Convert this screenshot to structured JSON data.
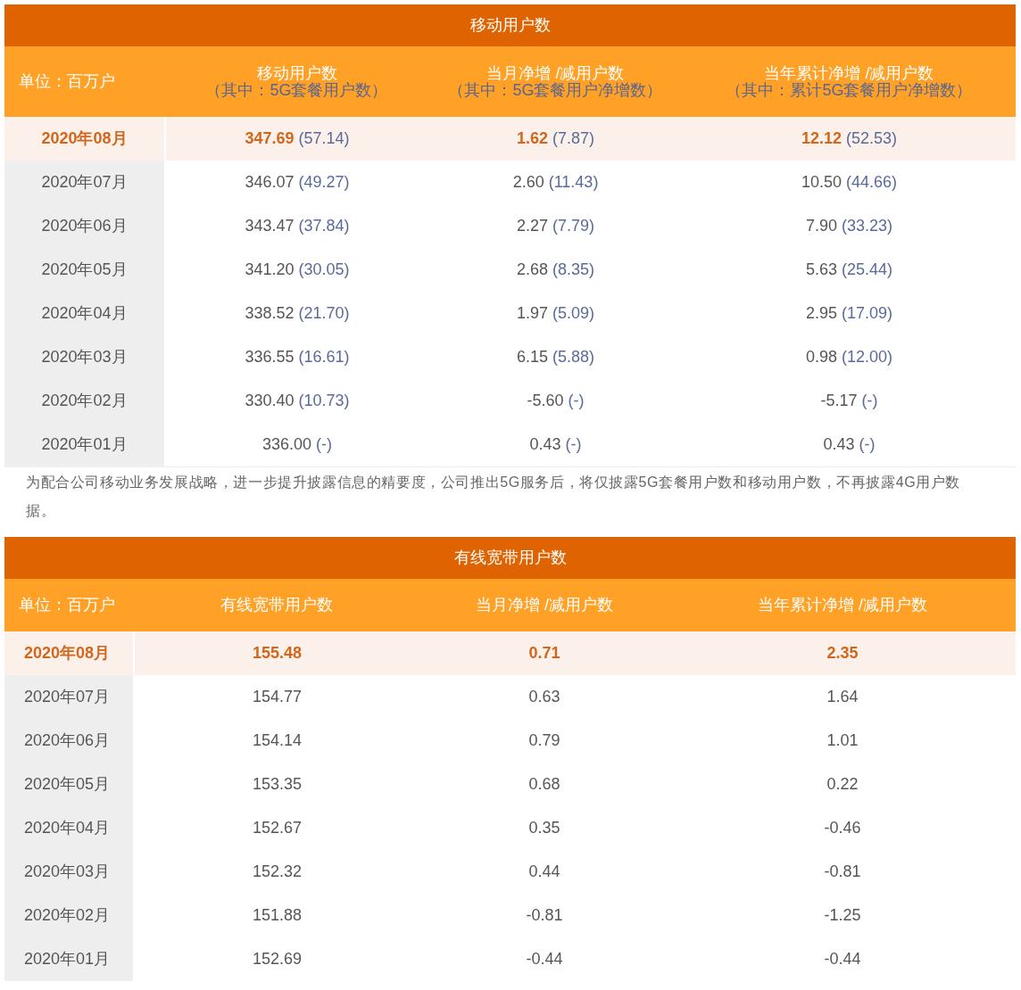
{
  "mobile_table": {
    "title": "移动用户数",
    "columns": [
      {
        "label": "单位：百万户"
      },
      {
        "label": "移动用户数",
        "sublabel": "（其中：5G套餐用户数）"
      },
      {
        "label": "当月净增 /减用户数",
        "sublabel": "（其中：5G套餐用户净增数）"
      },
      {
        "label": "当年累计净增 /减用户数",
        "sublabel": "（其中：累计5G套餐用户净增数）"
      }
    ],
    "rows": [
      {
        "highlight": true,
        "cells": [
          {
            "value": "2020年08月"
          },
          {
            "value": "347.69",
            "sub": "(57.14)"
          },
          {
            "value": "1.62",
            "sub": "(7.87)"
          },
          {
            "value": "12.12",
            "sub": "(52.53)"
          }
        ]
      },
      {
        "highlight": false,
        "cells": [
          {
            "value": "2020年07月"
          },
          {
            "value": "346.07",
            "sub": "(49.27)"
          },
          {
            "value": "2.60",
            "sub": "(11.43)"
          },
          {
            "value": "10.50",
            "sub": "(44.66)"
          }
        ]
      },
      {
        "highlight": false,
        "cells": [
          {
            "value": "2020年06月"
          },
          {
            "value": "343.47",
            "sub": "(37.84)"
          },
          {
            "value": "2.27",
            "sub": "(7.79)"
          },
          {
            "value": "7.90",
            "sub": "(33.23)"
          }
        ]
      },
      {
        "highlight": false,
        "cells": [
          {
            "value": "2020年05月"
          },
          {
            "value": "341.20",
            "sub": "(30.05)"
          },
          {
            "value": "2.68",
            "sub": "(8.35)"
          },
          {
            "value": "5.63",
            "sub": "(25.44)"
          }
        ]
      },
      {
        "highlight": false,
        "cells": [
          {
            "value": "2020年04月"
          },
          {
            "value": "338.52",
            "sub": "(21.70)"
          },
          {
            "value": "1.97",
            "sub": "(5.09)"
          },
          {
            "value": "2.95",
            "sub": "(17.09)"
          }
        ]
      },
      {
        "highlight": false,
        "cells": [
          {
            "value": "2020年03月"
          },
          {
            "value": "336.55",
            "sub": "(16.61)"
          },
          {
            "value": "6.15",
            "sub": "(5.88)"
          },
          {
            "value": "0.98",
            "sub": "(12.00)"
          }
        ]
      },
      {
        "highlight": false,
        "cells": [
          {
            "value": "2020年02月"
          },
          {
            "value": "330.40",
            "sub": "(10.73)"
          },
          {
            "value": "-5.60",
            "sub": "(-)"
          },
          {
            "value": "-5.17",
            "sub": "(-)"
          }
        ]
      },
      {
        "highlight": false,
        "cells": [
          {
            "value": "2020年01月"
          },
          {
            "value": "336.00",
            "sub": "(-)"
          },
          {
            "value": "0.43",
            "sub": "(-)"
          },
          {
            "value": "0.43",
            "sub": "(-)"
          }
        ]
      }
    ]
  },
  "note": "为配合公司移动业务发展战略，进一步提升披露信息的精要度，公司推出5G服务后，将仅披露5G套餐用户数和移动用户数，不再披露4G用户数据。",
  "broadband_table": {
    "title": "有线宽带用户数",
    "columns": [
      {
        "label": "单位：百万户"
      },
      {
        "label": "有线宽带用户数"
      },
      {
        "label": "当月净增 /减用户数"
      },
      {
        "label": "当年累计净增 /减用户数"
      }
    ],
    "rows": [
      {
        "highlight": true,
        "cells": [
          {
            "value": "2020年08月"
          },
          {
            "value": "155.48"
          },
          {
            "value": "0.71"
          },
          {
            "value": "2.35"
          }
        ]
      },
      {
        "highlight": false,
        "cells": [
          {
            "value": "2020年07月"
          },
          {
            "value": "154.77"
          },
          {
            "value": "0.63"
          },
          {
            "value": "1.64"
          }
        ]
      },
      {
        "highlight": false,
        "cells": [
          {
            "value": "2020年06月"
          },
          {
            "value": "154.14"
          },
          {
            "value": "0.79"
          },
          {
            "value": "1.01"
          }
        ]
      },
      {
        "highlight": false,
        "cells": [
          {
            "value": "2020年05月"
          },
          {
            "value": "153.35"
          },
          {
            "value": "0.68"
          },
          {
            "value": "0.22"
          }
        ]
      },
      {
        "highlight": false,
        "cells": [
          {
            "value": "2020年04月"
          },
          {
            "value": "152.67"
          },
          {
            "value": "0.35"
          },
          {
            "value": "-0.46"
          }
        ]
      },
      {
        "highlight": false,
        "cells": [
          {
            "value": "2020年03月"
          },
          {
            "value": "152.32"
          },
          {
            "value": "0.44"
          },
          {
            "value": "-0.81"
          }
        ]
      },
      {
        "highlight": false,
        "cells": [
          {
            "value": "2020年02月"
          },
          {
            "value": "151.88"
          },
          {
            "value": "-0.81"
          },
          {
            "value": "-1.25"
          }
        ]
      },
      {
        "highlight": false,
        "cells": [
          {
            "value": "2020年01月"
          },
          {
            "value": "152.69"
          },
          {
            "value": "-0.44"
          },
          {
            "value": "-0.44"
          }
        ]
      }
    ]
  }
}
